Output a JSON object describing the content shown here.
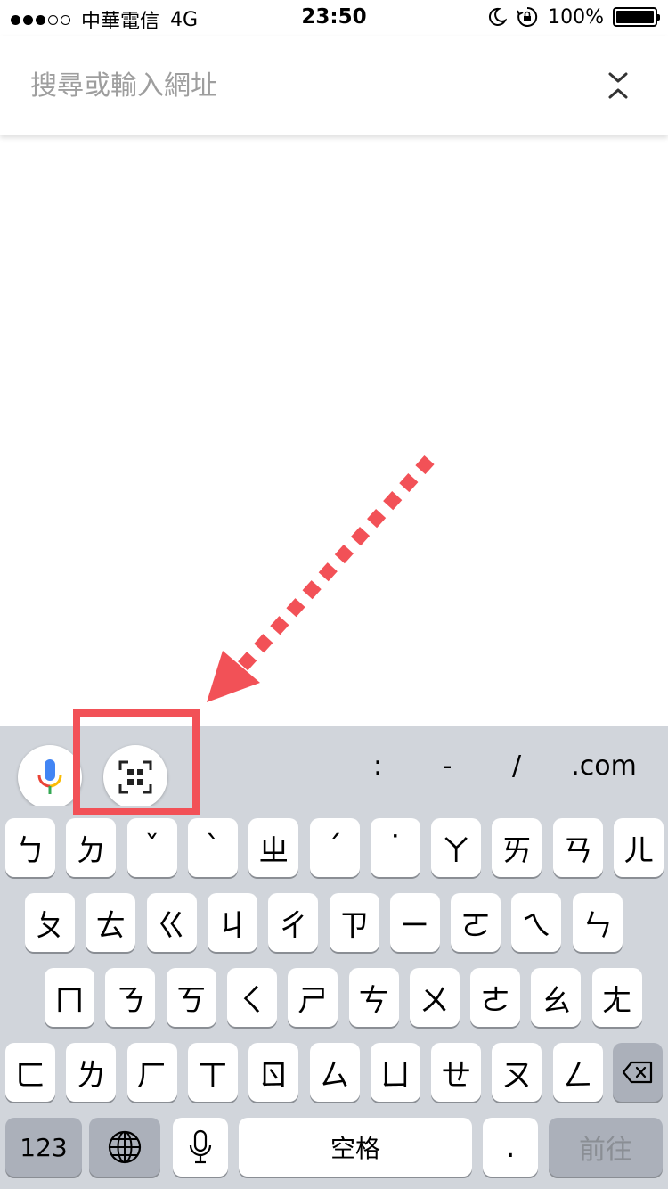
{
  "status_bar": {
    "carrier": "中華電信",
    "network": "4G",
    "time": "23:50",
    "battery": "100%",
    "battery_level": 1.0,
    "signal_strength": 3,
    "signal_total": 5,
    "icons": [
      "moon-icon",
      "rotation-lock-icon",
      "battery-icon"
    ]
  },
  "address_bar": {
    "placeholder": "搜尋或輸入網址",
    "collapse_icon": "collapse-chevrons-icon"
  },
  "accessory_bar": {
    "voice_icon": "google-mic-icon",
    "qr_icon": "qr-scan-icon",
    "keys": [
      ":",
      "-",
      "/",
      ".com"
    ]
  },
  "keyboard": {
    "rows": [
      [
        "ㄅ",
        "ㄉ",
        "ˇ",
        "ˋ",
        "ㄓ",
        "ˊ",
        "˙",
        "ㄚ",
        "ㄞ",
        "ㄢ",
        "ㄦ"
      ],
      [
        "ㄆ",
        "ㄊ",
        "ㄍ",
        "ㄐ",
        "ㄔ",
        "ㄗ",
        "ㄧ",
        "ㄛ",
        "ㄟ",
        "ㄣ"
      ],
      [
        "ㄇ",
        "ㄋ",
        "ㄎ",
        "ㄑ",
        "ㄕ",
        "ㄘ",
        "ㄨ",
        "ㄜ",
        "ㄠ",
        "ㄤ"
      ],
      [
        "ㄈ",
        "ㄌ",
        "ㄏ",
        "ㄒ",
        "ㄖ",
        "ㄙ",
        "ㄩ",
        "ㄝ",
        "ㄡ",
        "ㄥ"
      ]
    ],
    "delete_icon": "backspace-icon",
    "numbers_key": "123",
    "globe_icon": "globe-icon",
    "mic_icon": "mic-icon",
    "space_key": "空格",
    "period_key": ".",
    "go_key": "前往"
  },
  "colors": {
    "accent_highlight": "#f25157",
    "keyboard_bg": "#d1d5db",
    "dark_key": "#abb0ba"
  }
}
